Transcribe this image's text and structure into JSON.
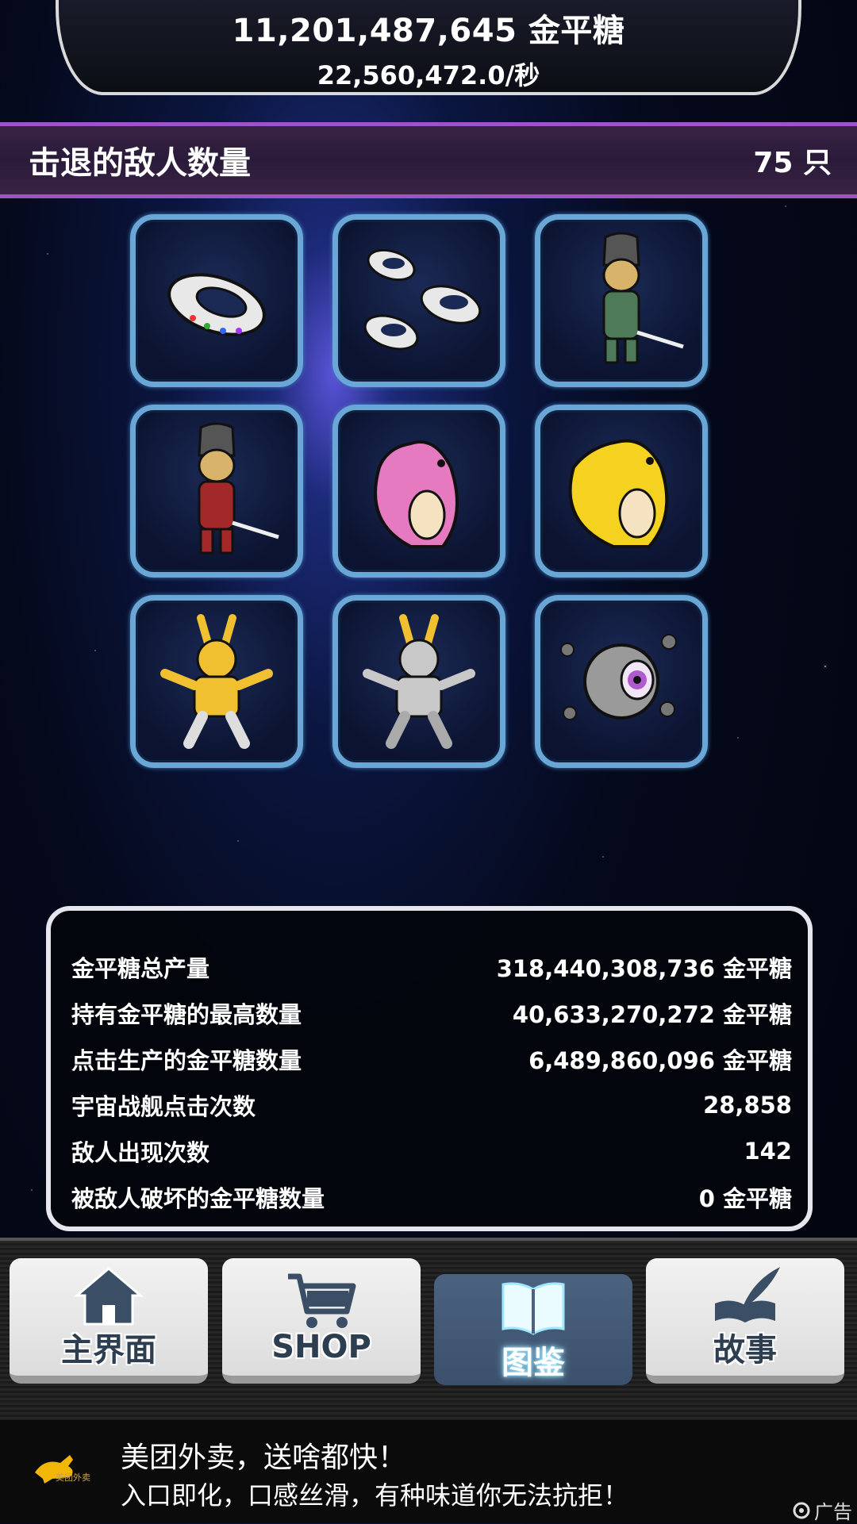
{
  "top": {
    "total": "11,201,487,645 金平糖",
    "rate": "22,560,472.0/秒"
  },
  "defeated": {
    "title": "击退的敌人数量",
    "count": "75 只"
  },
  "enemies": [
    {
      "icon": "ufo-ship-icon"
    },
    {
      "icon": "ufo-fleet-icon"
    },
    {
      "icon": "predator-green-icon"
    },
    {
      "icon": "predator-red-icon"
    },
    {
      "icon": "pink-kaiju-icon"
    },
    {
      "icon": "yellow-kaiju-icon"
    },
    {
      "icon": "gold-rabbit-robot-icon"
    },
    {
      "icon": "silver-rabbit-robot-icon"
    },
    {
      "icon": "eye-planet-icon"
    }
  ],
  "stats": [
    {
      "label": "金平糖总产量",
      "value": "318,440,308,736 金平糖"
    },
    {
      "label": "持有金平糖的最高数量",
      "value": "40,633,270,272 金平糖"
    },
    {
      "label": "点击生产的金平糖数量",
      "value": "6,489,860,096 金平糖"
    },
    {
      "label": "宇宙战舰点击次数",
      "value": "28,858"
    },
    {
      "label": "敌人出现次数",
      "value": "142"
    },
    {
      "label": "被敌人破坏的金平糖数量",
      "value": "0 金平糖"
    }
  ],
  "nav": {
    "home": "主界面",
    "shop": "SHOP",
    "encyclopedia": "图鉴",
    "story": "故事"
  },
  "ad": {
    "title": "美团外卖，送啥都快！",
    "subtitle": "入口即化，口感丝滑，有种味道你无法抗拒！",
    "brand_small": "美团外卖",
    "badge": "广告"
  }
}
